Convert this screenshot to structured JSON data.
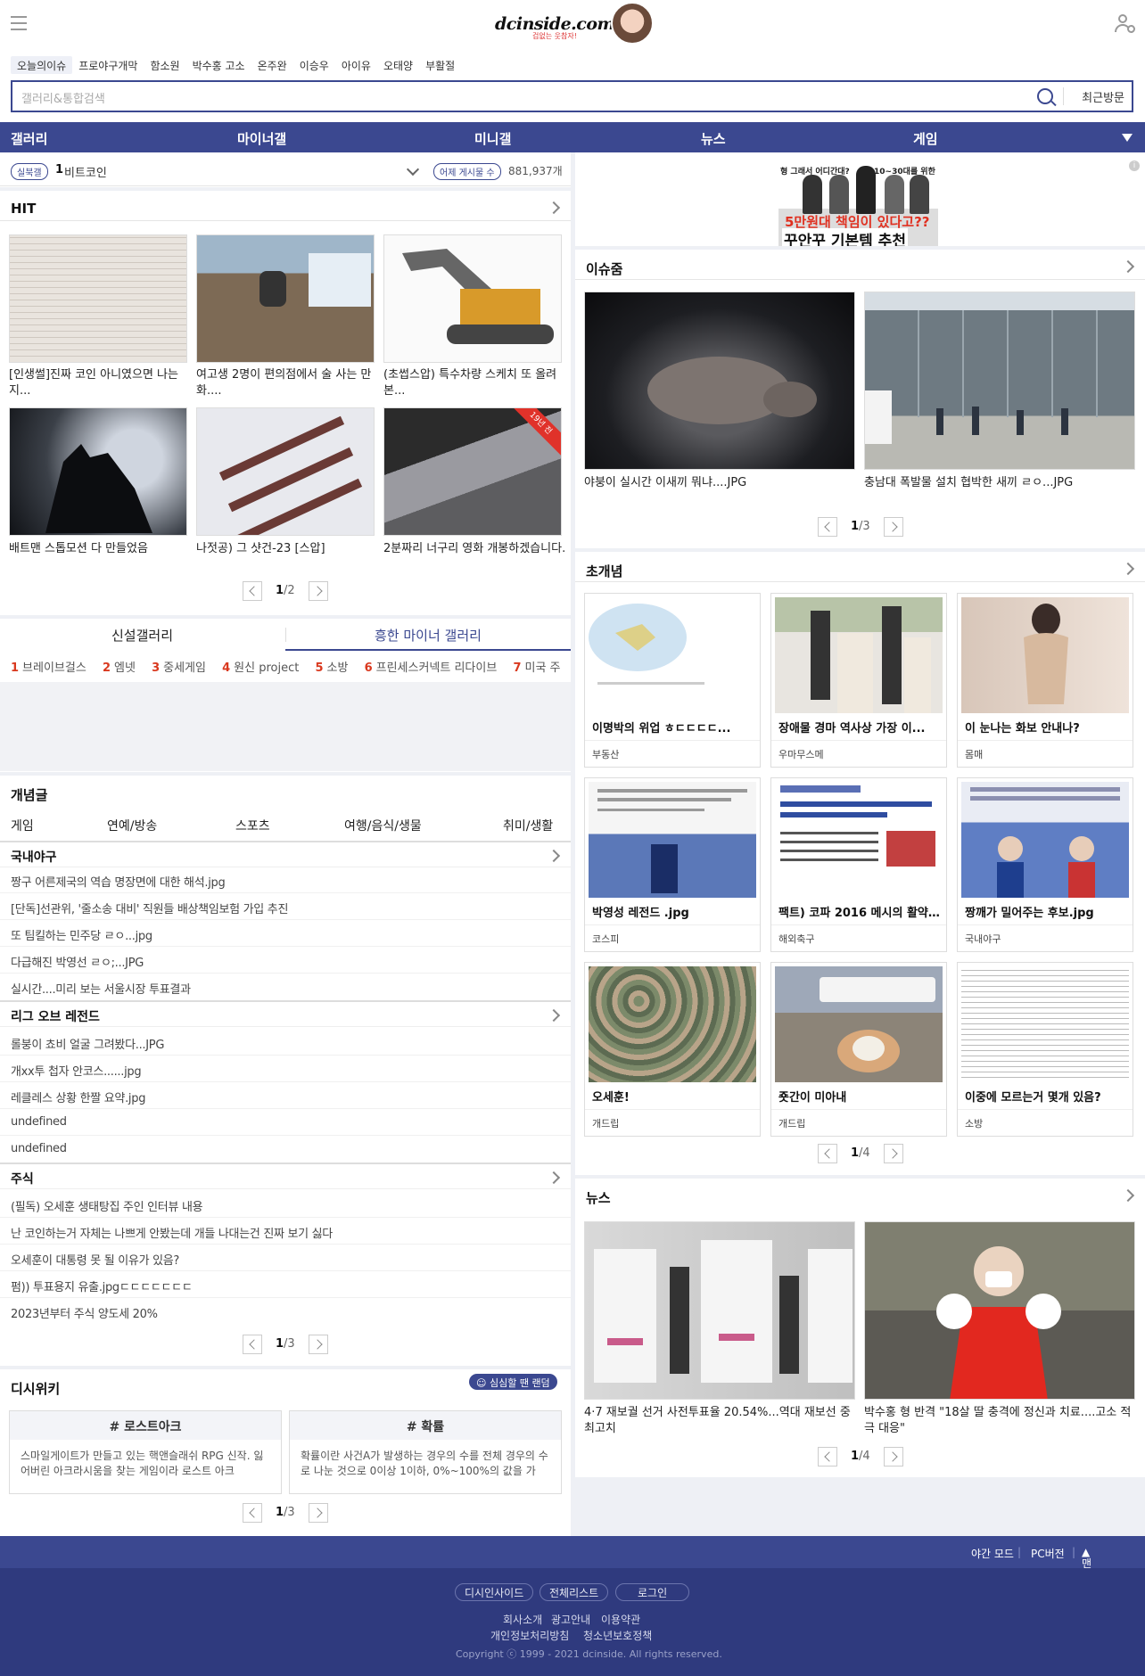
{
  "header": {
    "logo": "dcinside.com",
    "logo_sub": "겁없는 웃참자!"
  },
  "issue_keywords": [
    "오늘의이슈",
    "프로야구개막",
    "함소원",
    "박수홍 고소",
    "온주완",
    "이승우",
    "아이유",
    "오태양",
    "부활절"
  ],
  "search": {
    "placeholder": "갤러리&통합검색",
    "recent_label": "최근방문"
  },
  "nav": [
    "갤러리",
    "마이너갤",
    "미니갤",
    "뉴스",
    "게임"
  ],
  "realtime": {
    "badge": "실북갤",
    "rank": "1",
    "text": "비트코인",
    "badge2": "어제 게시물 수",
    "count": "881,937개"
  },
  "hit": {
    "title": "HIT",
    "items": [
      {
        "caption": "[인생썰]진짜 코인 아니였으면 나는 지..."
      },
      {
        "caption": "여고생 2명이 편의점에서 술 사는 만화...."
      },
      {
        "caption": "(초썹스압) 특수차량 스케치 또 올려본..."
      },
      {
        "caption": "배트맨 스톱모션 다 만들었음"
      },
      {
        "caption": "나젓공) 그 샷건-23 [스압]"
      },
      {
        "caption": "2분짜리 너구리 영화 개봉하겠습니다."
      }
    ],
    "ribbon": "19년 전",
    "pager": {
      "current": "1",
      "total": "/2"
    }
  },
  "gallery_tabs": {
    "tab1": "신설갤러리",
    "tab2": "흥한 마이너 갤러리"
  },
  "ranking": [
    {
      "n": "1",
      "name": "브레이브걸스"
    },
    {
      "n": "2",
      "name": "엠넷"
    },
    {
      "n": "3",
      "name": "중세게임"
    },
    {
      "n": "4",
      "name": "원신 project"
    },
    {
      "n": "5",
      "name": "소방"
    },
    {
      "n": "6",
      "name": "프린세스커넥트 리다이브"
    },
    {
      "n": "7",
      "name": "미국 주"
    }
  ],
  "concept": {
    "title": "개념글",
    "categories": [
      "게임",
      "연예/방송",
      "스포츠",
      "여행/음식/생물",
      "취미/생활"
    ],
    "groups": [
      {
        "title": "국내야구",
        "posts": [
          "짱구 어른제국의 역습 명장면에 대한 해석.jpg",
          "[단독]선관위, '줄소송 대비' 직원들 배상책임보험 가입 추진",
          "또 팀킬하는 민주당 ㄹㅇ...jpg",
          "다급해진 박영선 ㄹㅇ;...JPG",
          "실시간....미리 보는 서울시장 투표결과"
        ]
      },
      {
        "title": "리그 오브 레전드",
        "posts": [
          "롤붕이 쵸비 얼굴 그려봤다...JPG",
          "개xx투 첩자 안코스......jpg",
          "레클레스 상황 한짤 요약.jpg",
          "undefined",
          "undefined"
        ]
      },
      {
        "title": "주식",
        "posts": [
          "(필독) 오세훈 생태탕집 주인 인터뷰 내용",
          "난 코인하는거 자체는 나쁘게 안봤는데 개들 나대는건 진짜 보기 싫다",
          "오세훈이 대통령 못 될 이유가 있음?",
          "펌)) 투표용지 유출.jpgㄷㄷㄷㄷㄷㄷㄷ",
          "2023년부터 주식 양도세 20%"
        ]
      }
    ],
    "pager": {
      "current": "1",
      "total": "/3"
    }
  },
  "wiki": {
    "title": "디시위키",
    "badge": "심심할 땐 랜덤",
    "cards": [
      {
        "title": "# 로스트아크",
        "desc": "스마일게이트가 만들고 있는 핵앤슬래쉬 RPG 신작. 잃어버린 아크라시움을 찾는 게임이라 로스트 아크"
      },
      {
        "title": "# 확률",
        "desc": "확률이란 사건A가 발생하는 경우의 수를 전체 경우의 수로 나눈 것으로 0이상 1이하, 0%~100%의 값을 가"
      }
    ],
    "pager": {
      "current": "1",
      "total": "/3"
    }
  },
  "ad": {
    "line1": "형 그래서 어디간대?",
    "line2": "10~30대를 위한",
    "big1": "5만원대 책임이 있다고??",
    "big2": "꾸안꾸 기본템 추천",
    "info": "i"
  },
  "issue_zoom": {
    "title": "이슈줌",
    "items": [
      {
        "caption": "야붕이 실시간 이새끼 뭐냐....JPG"
      },
      {
        "caption": "충남대 폭발물 설치 협박한 새끼 ㄹㅇ...JPG"
      }
    ],
    "pager": {
      "current": "1",
      "total": "/3"
    }
  },
  "super_concept": {
    "title": "초개념",
    "cards": [
      {
        "title": "이명박의 위업 ㅎㄷㄷㄷㄷ...",
        "gallery": "부동산"
      },
      {
        "title": "장애물 경마 역사상 가장 이...",
        "gallery": "우마무스메"
      },
      {
        "title": "이 눈나는 화보 안내나?",
        "gallery": "몸매"
      },
      {
        "title": "박영성 레전드 .jpg",
        "gallery": "코스피"
      },
      {
        "title": "팩트) 코파 2016 메시의 활약...",
        "gallery": "해외축구"
      },
      {
        "title": "짱깨가 밀어주는 후보.jpg",
        "gallery": "국내야구"
      },
      {
        "title": "오세훈!",
        "gallery": "개드립"
      },
      {
        "title": "죳간이 미아내",
        "gallery": "개드립"
      },
      {
        "title": "이중에 모르는거 몇개 있음?",
        "gallery": "소방"
      }
    ],
    "pager": {
      "current": "1",
      "total": "/4"
    }
  },
  "news": {
    "title": "뉴스",
    "items": [
      {
        "caption": "4·7 재보궐 선거 사전투표율 20.54%...역대 재보선 중 최고치"
      },
      {
        "caption": "박수홍 형 반격 \"18살 딸 충격에 정신과 치료....고소 적극 대응\""
      }
    ],
    "pager": {
      "current": "1",
      "total": "/4"
    }
  },
  "footer": {
    "night": "야간 모드",
    "pc": "PC버전",
    "top": "맨위로",
    "buttons": [
      "디시인사이드",
      "전체리스트",
      "로그인"
    ],
    "links1": [
      "회사소개",
      "광고안내",
      "이용약관"
    ],
    "links2": [
      "개인정보처리방침",
      "청소년보호정책"
    ],
    "copyright": "Copyright ⓒ 1999 - 2021 dcinside. All rights reserved."
  },
  "colors": {
    "accent": "#3b4890",
    "rank": "#d9381e",
    "footer": "#2f3a7e"
  }
}
